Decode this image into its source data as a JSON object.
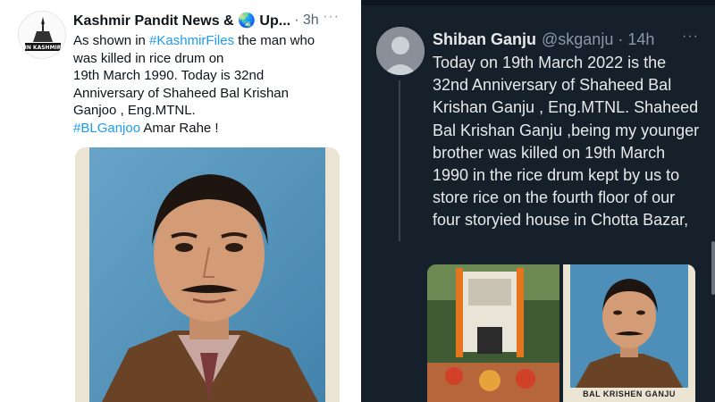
{
  "left_tweet": {
    "author_name": "Kashmir Pandit News & 🌏 Up...",
    "time": "· 3h",
    "more_label": "···",
    "avatar_text": "IN KASHMIR",
    "lines": [
      {
        "pre": "As shown in ",
        "tag": "#KashmirFiles",
        "post": " the man who"
      },
      {
        "pre": "was killed in rice drum on",
        "tag": "",
        "post": ""
      },
      {
        "pre": "19th March 1990.  Today is 32nd",
        "tag": "",
        "post": ""
      },
      {
        "pre": "Anniversary of Shaheed Bal Krishan",
        "tag": "",
        "post": ""
      },
      {
        "pre": "Ganjoo , Eng.MTNL.",
        "tag": "",
        "post": ""
      },
      {
        "pre": "",
        "tag": "#BLGanjoo",
        "post": " Amar Rahe !"
      }
    ]
  },
  "right_tweet": {
    "author_name": "Shiban Ganju",
    "handle": "@skganju · 14h",
    "more_label": "···",
    "text": "Today on 19th March 2022 is the 32nd Anniversary of Shaheed Bal Krishan Ganju , Eng.MTNL. Shaheed Bal Krishan Ganju ,being my younger brother was killed on 19th March 1990 in the rice drum kept by us to store rice on the fourth floor of our four storyied house in Chotta Bazar,",
    "photo_caption": "BAL KRISHEN GANJU"
  },
  "colors": {
    "dark_bg": "#15202b",
    "link": "#1d9bf0",
    "dark_text": "#e7e9ea",
    "muted": "#8b98a5"
  }
}
